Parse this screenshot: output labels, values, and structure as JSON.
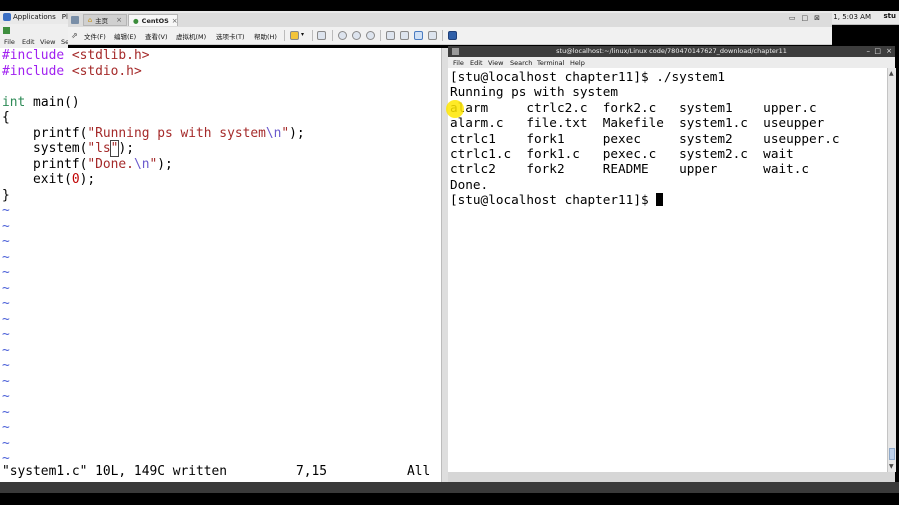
{
  "gnome_panel": {
    "applications_label": "Applications",
    "places_label": "Pl",
    "clock": "l 1, 5:03 AM",
    "user": "stu"
  },
  "gvim_menu": {
    "file": "File",
    "edit": "Edit",
    "view": "View",
    "search": "Se"
  },
  "vmware": {
    "tabs": [
      {
        "label": "主页"
      },
      {
        "label": "CentOS"
      }
    ],
    "menu": {
      "file": "文件(F)",
      "edit": "编辑(E)",
      "view": "查看(V)",
      "vm": "虚拟机(M)",
      "tabs": "选项卡(T)",
      "help": "帮助(H)"
    }
  },
  "vim": {
    "lines": [
      "#include <stdlib.h>",
      "#include <stdio.h>",
      "",
      "int main()",
      "{",
      "    printf(\"Running ps with system\\n\");",
      "    system(\"ls\");",
      "    printf(\"Done.\\n\");",
      "    exit(0);",
      "}"
    ],
    "tilde": "~",
    "status_message": "\"system1.c\" 10L, 149C written",
    "cursor_position": "7,15",
    "scroll_position": "All"
  },
  "terminal": {
    "title": "stu@localhost:~/linux/Linux code/780470147627_download/chapter11",
    "menu": {
      "file": "File",
      "edit": "Edit",
      "view": "View",
      "search": "Search",
      "terminal": "Terminal",
      "help": "Help"
    },
    "lines": [
      "[stu@localhost chapter11]$ ./system1",
      "Running ps with system",
      "alarm     ctrlc2.c  fork2.c   system1    upper.c",
      "alarm.c   file.txt  Makefile  system1.c  useupper",
      "ctrlc1    fork1     pexec     system2    useupper.c",
      "ctrlc1.c  fork1.c   pexec.c   system2.c  wait",
      "ctrlc2    fork2     README    upper      wait.c",
      "Done."
    ],
    "prompt": "[stu@localhost chapter11]$ "
  }
}
